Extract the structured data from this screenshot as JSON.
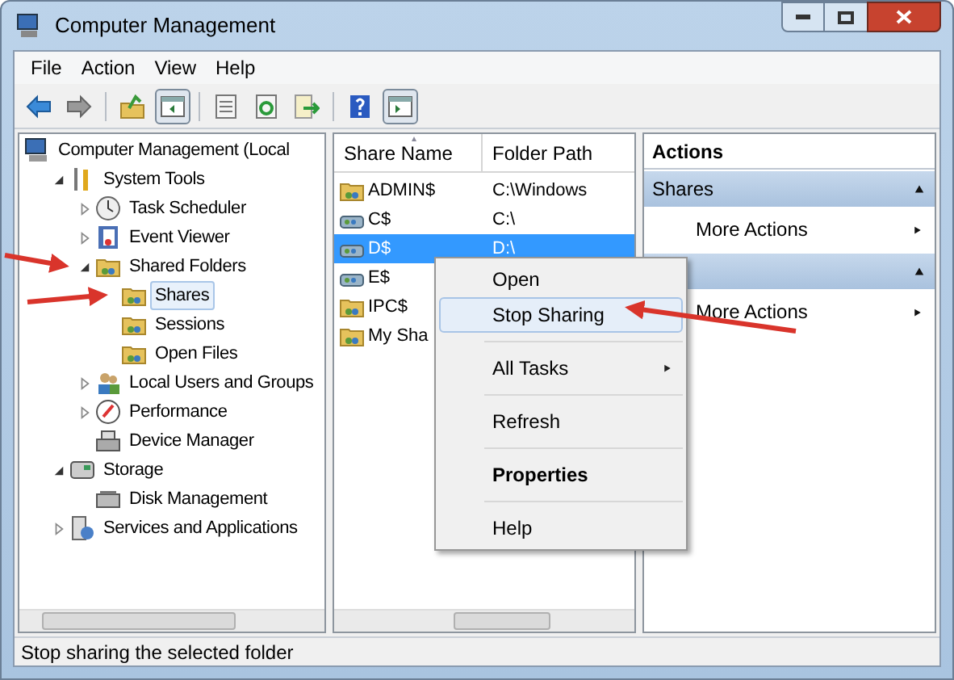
{
  "window": {
    "title": "Computer Management"
  },
  "menu": [
    "File",
    "Action",
    "View",
    "Help"
  ],
  "toolbar": [
    {
      "kind": "back",
      "pressed": false
    },
    {
      "kind": "forward",
      "pressed": false
    },
    {
      "kind": "sep"
    },
    {
      "kind": "up",
      "pressed": false
    },
    {
      "kind": "tree",
      "pressed": true
    },
    {
      "kind": "sep"
    },
    {
      "kind": "properties",
      "pressed": false
    },
    {
      "kind": "refresh",
      "pressed": false
    },
    {
      "kind": "export",
      "pressed": false
    },
    {
      "kind": "sep"
    },
    {
      "kind": "help",
      "pressed": false
    },
    {
      "kind": "actionpane",
      "pressed": true
    }
  ],
  "tree": [
    {
      "label": "Computer Management (Local",
      "kind": "computer",
      "selected": false,
      "children": [
        {
          "label": "System Tools",
          "kind": "tools",
          "expanded": true,
          "selected": false,
          "children": [
            {
              "label": "Task Scheduler",
              "kind": "clock",
              "expanded": false,
              "selected": false
            },
            {
              "label": "Event Viewer",
              "kind": "log",
              "expanded": false,
              "selected": false
            },
            {
              "label": "Shared Folders",
              "kind": "share",
              "expanded": true,
              "selected": false,
              "children": [
                {
                  "label": "Shares",
                  "kind": "share",
                  "selected": true
                },
                {
                  "label": "Sessions",
                  "kind": "share",
                  "selected": false
                },
                {
                  "label": "Open Files",
                  "kind": "share",
                  "selected": false
                }
              ]
            },
            {
              "label": "Local Users and Groups",
              "kind": "users",
              "expanded": false,
              "selected": false
            },
            {
              "label": "Performance",
              "kind": "gauge",
              "expanded": false,
              "selected": false
            },
            {
              "label": "Device Manager",
              "kind": "device",
              "selected": false
            }
          ]
        },
        {
          "label": "Storage",
          "kind": "storage",
          "expanded": true,
          "selected": false,
          "children": [
            {
              "label": "Disk Management",
              "kind": "disk",
              "selected": false
            }
          ]
        },
        {
          "label": "Services and Applications",
          "kind": "services",
          "expanded": false,
          "selected": false
        }
      ]
    }
  ],
  "shares": {
    "columns": [
      "Share Name",
      "Folder Path"
    ],
    "rows": [
      {
        "name": "ADMIN$",
        "path": "C:\\Windows",
        "kind": "folder",
        "selected": false
      },
      {
        "name": "C$",
        "path": "C:\\",
        "kind": "drive",
        "selected": false
      },
      {
        "name": "D$",
        "path": "D:\\",
        "kind": "drive",
        "selected": true
      },
      {
        "name": "E$",
        "kind": "drive",
        "selected": false
      },
      {
        "name": "IPC$",
        "kind": "folder",
        "selected": false
      },
      {
        "name": "My Sha",
        "kind": "folder",
        "selected": false
      }
    ]
  },
  "context_menu": [
    {
      "kind": "item",
      "label": "Open",
      "selected": false
    },
    {
      "kind": "item",
      "label": "Stop Sharing",
      "selected": true
    },
    {
      "kind": "sep"
    },
    {
      "kind": "submenu",
      "label": "All Tasks",
      "selected": false
    },
    {
      "kind": "sep"
    },
    {
      "kind": "item",
      "label": "Refresh",
      "selected": false
    },
    {
      "kind": "sep"
    },
    {
      "kind": "default",
      "label": "Properties",
      "selected": false
    },
    {
      "kind": "sep"
    },
    {
      "kind": "item",
      "label": "Help",
      "selected": false
    }
  ],
  "actions": {
    "title": "Actions",
    "sections": [
      {
        "title": "Shares",
        "items": [
          "More Actions"
        ]
      },
      {
        "items": [
          "More Actions"
        ]
      }
    ]
  },
  "status_bar": "Stop sharing the selected folder"
}
